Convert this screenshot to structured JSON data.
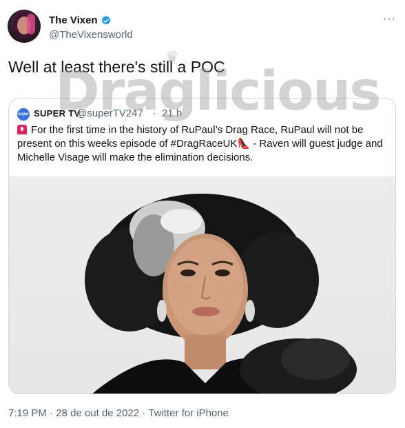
{
  "author": {
    "display_name": "The Vixen",
    "handle": "@TheVixensworld"
  },
  "tweet": {
    "text": "Well at least there's still a POC"
  },
  "watermark": {
    "text": "Draglicious"
  },
  "quoted": {
    "avatar_text": "super",
    "name": "SUPER TV",
    "handle": "@superTV247",
    "separator": "·",
    "time": "21 h",
    "text_part1": "For the first time in the history of RuPaul’s Drag Race, RuPaul will not be present on this weeks episode of #DragRaceUK",
    "text_part2": " - Raven will guest judge and Michelle Visage will make the elimination decisions.",
    "icons": [
      "alarm-icon",
      "high-heel-icon"
    ]
  },
  "meta": {
    "time": "7:19 PM",
    "separator1": " · ",
    "date": "28 de out de 2022",
    "separator2": " · ",
    "source": "Twitter for iPhone"
  },
  "colors": {
    "verified": "#1d9bf0",
    "secondary_text": "#536471",
    "border": "#cfd9de"
  }
}
